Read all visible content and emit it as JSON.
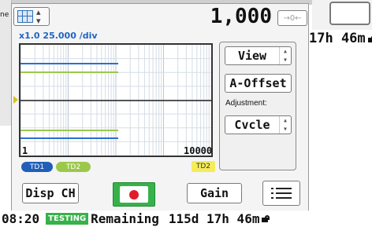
{
  "header": {
    "value": "1,000",
    "zoom_button": "→0←",
    "scale": "x1.0 25.000 /div"
  },
  "plot": {
    "x_min_label": "1",
    "x_max_label": "10000"
  },
  "traces": {
    "td1": "TD1",
    "td2_left": "TD2",
    "td2_right": "TD2"
  },
  "side": {
    "view": "View",
    "a_offset": "A-Offset",
    "adjustment_label": "Adjustment:",
    "cycle": "Cvcle"
  },
  "bottom": {
    "disp_ch": "Disp CH",
    "gain": "Gain"
  },
  "status": {
    "time": "08:20",
    "state": "TESTING",
    "remaining_label": "Remaining",
    "remaining_value": "115d 17h 46m"
  },
  "background": {
    "right_fragment": "17h 46m"
  },
  "colors": {
    "accent_green": "#37b24a",
    "scale_blue": "#1f66c2",
    "td1_blue": "#1f5fb8",
    "td2_green": "#9cc84a",
    "td2_yellow": "#f4ec5a"
  }
}
